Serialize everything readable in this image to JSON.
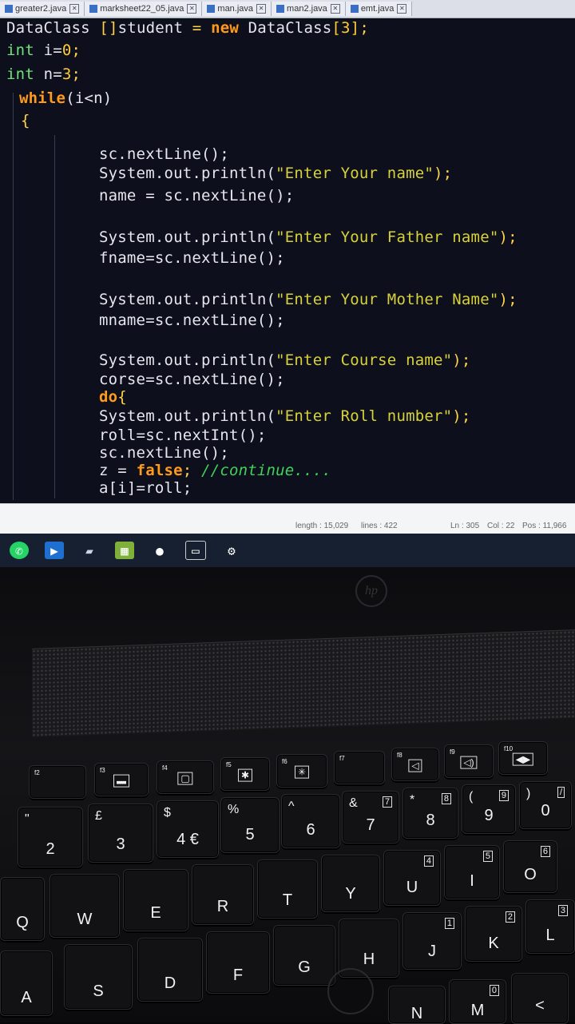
{
  "tabs": [
    {
      "label": "greater2.java"
    },
    {
      "label": "marksheet22_05.java"
    },
    {
      "label": "man.java"
    },
    {
      "label": "man2.java"
    },
    {
      "label": "emt.java"
    }
  ],
  "code": {
    "l1": {
      "a": "DataClass ",
      "b": "[]",
      "c": "student ",
      "d": "= ",
      "e": "new ",
      "f": "DataClass",
      "g": "[3]",
      "h": ";"
    },
    "l2": {
      "a": "int ",
      "b": "i=",
      "c": "0",
      "d": ";"
    },
    "l3": {
      "a": "int ",
      "b": "n=",
      "c": "3",
      "d": ";"
    },
    "l4": {
      "a": "while",
      "b": "(i<n)"
    },
    "l5": "{",
    "l6": "sc.nextLine();",
    "l7a": "System.out.println(",
    "l7b": "\"Enter Your name\"",
    "l7c": ");",
    "l8": "name = sc.nextLine();",
    "l9a": "System.out.println(",
    "l9b": "\"Enter Your Father name\"",
    "l9c": ");",
    "l10": "fname=sc.nextLine();",
    "l11a": "System.out.println(",
    "l11b": "\"Enter Your Mother Name\"",
    "l11c": ");",
    "l12": "mname=sc.nextLine();",
    "l13a": "System.out.println(",
    "l13b": "\"Enter Course name\"",
    "l13c": ");",
    "l14": "corse=sc.nextLine();",
    "l15a": "do",
    "l15b": "{",
    "l16a": "System.out.println(",
    "l16b": "\"Enter Roll number\"",
    "l16c": ");",
    "l17": "roll=sc.nextInt();",
    "l18": "sc.nextLine();",
    "l19a": "z = ",
    "l19b": "false",
    "l19c": "; ",
    "l19d": "//continue....",
    "l20": "a[i]=roll;"
  },
  "status": {
    "length": "length : 15,029",
    "lines": "lines : 422",
    "ln": "Ln : 305",
    "col": "Col : 22",
    "pos": "Pos : 11,966"
  },
  "taskbar": [
    {
      "icon": "whatsapp-icon",
      "glyph": "✆"
    },
    {
      "icon": "terminal-icon",
      "glyph": "▶"
    },
    {
      "icon": "folder-icon",
      "glyph": "▰"
    },
    {
      "icon": "notepad-icon",
      "glyph": "▦"
    },
    {
      "icon": "github-icon",
      "glyph": "●"
    },
    {
      "icon": "window-icon",
      "glyph": "▭"
    },
    {
      "icon": "settings-icon",
      "glyph": "⚙"
    }
  ],
  "keyboard": {
    "f2": "f2",
    "f3": "f3",
    "f4": "f4",
    "f5": "f5",
    "f6": "f6",
    "f7": "f7",
    "f8": "f8",
    "f9": "f9",
    "f10": "f10",
    "k2_top": "\"",
    "k2": "2",
    "k3_top": "£",
    "k3": "3",
    "k4_top": "$",
    "k4": "4  €",
    "k5_top": "%",
    "k5": "5",
    "k6_top": "^",
    "k6": "6",
    "k7_top": "&",
    "k7": "7",
    "k7_sub": "7",
    "k8_top": "*",
    "k8": "8",
    "k8_sub": "8",
    "k9_top": "(",
    "k9": "9",
    "k9_sub": "9",
    "k0_top": ")",
    "k0": "0",
    "k0_sub": "/",
    "q": "Q",
    "w": "W",
    "e": "E",
    "r": "R",
    "t": "T",
    "y": "Y",
    "u": "U",
    "u_sub": "4",
    "i": "I",
    "i_sub": "5",
    "o": "O",
    "o_sub": "6",
    "a": "A",
    "s": "S",
    "d": "D",
    "f": "F",
    "g": "G",
    "h": "H",
    "j": "J",
    "j_sub": "1",
    "k": "K",
    "k_sub": "2",
    "l": "L",
    "l_sub": "3",
    "n": "N",
    "m": "M",
    "m_sub": "0",
    "comma": "<"
  }
}
